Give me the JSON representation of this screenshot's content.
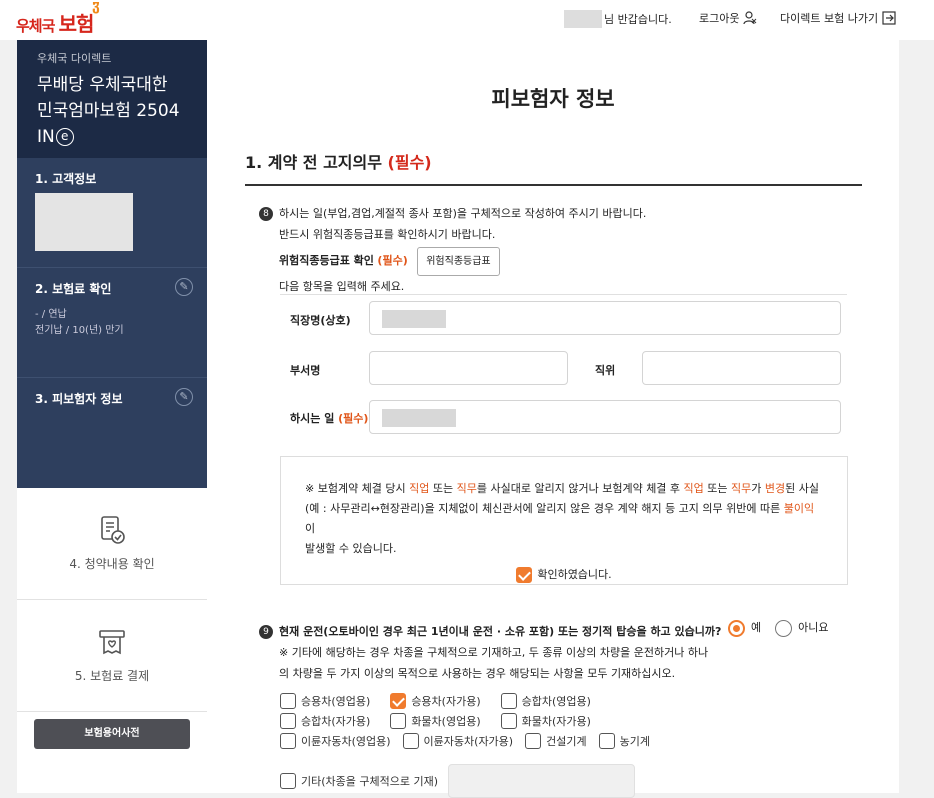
{
  "header": {
    "logo_text_small": "우체국",
    "logo_text_big": "보험",
    "greeting": "님 반갑습니다.",
    "logout": "로그아웃",
    "exit": "다이렉트 보험 나가기"
  },
  "sidebar": {
    "sub": "우체국 다이렉트",
    "product_line1": "무배당 우체국대한",
    "product_line2": "민국엄마보험 2504",
    "product_line3": "IN",
    "product_badge": "e",
    "steps": [
      {
        "label": "1. 고객정보"
      },
      {
        "label": "2. 보험료 확인",
        "detail1": "- / 연납",
        "detail2": "전기납 / 10(년) 만기"
      },
      {
        "label": "3. 피보험자 정보"
      },
      {
        "label": "4. 청약내용 확인"
      },
      {
        "label": "5. 보험료 결제"
      }
    ],
    "dictionary_button": "보험용어사전"
  },
  "main": {
    "page_title": "피보험자 정보",
    "section_title": "1. 계약 전 고지의무",
    "section_required": "(필수)",
    "q8": {
      "number": "8",
      "line1": "하시는 일(부업,겸업,계절적 종사 포함)을 구체적으로 작성하여 주시기 바랍니다.",
      "line2": "반드시 위험직종등급표를 확인하시기 바랍니다.",
      "confirm_label": "위험직종등급표 확인",
      "confirm_required": "(필수)",
      "grade_button": "위험직종등급표",
      "line3": "다음 항목을 입력해 주세요."
    },
    "form": {
      "workplace_label": "직장명(상호)",
      "department_label": "부서명",
      "position_label": "직위",
      "job_label": "하시는 일",
      "job_required": "(필수)"
    },
    "notice": {
      "p1": "※ 보험계약 체결 당시 ",
      "w1": "직업",
      "p2": " 또는 ",
      "w2": "직무",
      "p3": "를 사실대로 알리지 않거나 보험계약 체결 후 ",
      "w3": "직업",
      "p4": " 또는 ",
      "w4": "직무",
      "p5": "가 ",
      "w5": "변경",
      "p6": "된 사실",
      "p7": "(예 : 사무관리↔현장관리)을 지체없이 체신관서에 알리지 않은 경우 계약 해지 등 고지 의무 위반에 따른 ",
      "w6": "불이익",
      "p8": "이",
      "p9": "발생할 수 있습니다.",
      "confirm_checkbox": "확인하였습니다.",
      "confirm_checked": true
    },
    "q9": {
      "number": "9",
      "question": "현재 운전(오토바이인 경우 최근 1년이내 운전 · 소유 포함) 또는 정기적 탑승을 하고 있습니까?",
      "yes": "예",
      "no": "아니요",
      "selected": "예",
      "note1": "※ 기타에 해당하는 경우 차종을 구체적으로 기재하고, 두 종류 이상의 차량을 운전하거나 하나",
      "note2": "의 차량을 두 가지 이상의 목적으로 사용하는 경우 해당되는 사항을 모두 기재하십시오."
    },
    "vehicles": {
      "row1": [
        {
          "label": "승용차(영업용)",
          "checked": false
        },
        {
          "label": "승용차(자가용)",
          "checked": true
        },
        {
          "label": "승합차(영업용)",
          "checked": false
        }
      ],
      "row2": [
        {
          "label": "승합차(자가용)",
          "checked": false
        },
        {
          "label": "화물차(영업용)",
          "checked": false
        },
        {
          "label": "화물차(자가용)",
          "checked": false
        }
      ],
      "row3": [
        {
          "label": "이륜자동차(영업용)",
          "checked": false
        },
        {
          "label": "이륜자동차(자가용)",
          "checked": false
        },
        {
          "label": "건설기계",
          "checked": false
        },
        {
          "label": "농기계",
          "checked": false
        }
      ],
      "other": {
        "label": "기타(차종을 구체적으로 기재)",
        "checked": false
      }
    }
  }
}
